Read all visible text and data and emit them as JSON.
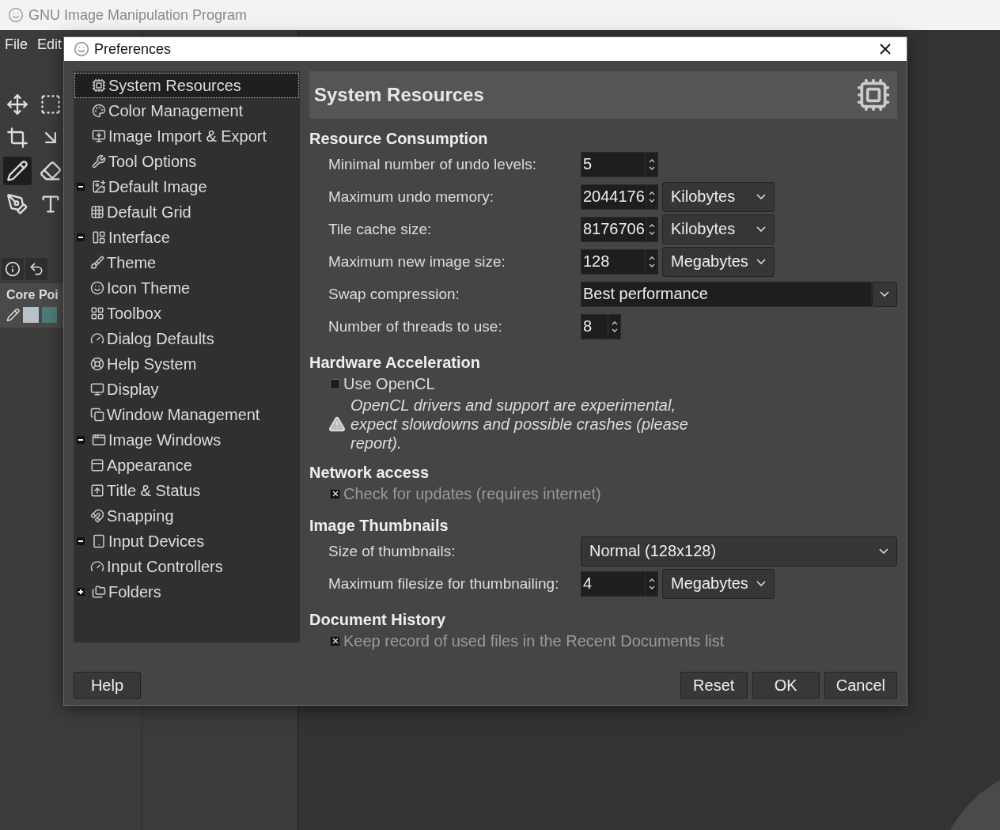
{
  "app": {
    "title": "GNU Image Manipulation Program",
    "menu": [
      "File",
      "Edit"
    ],
    "dock_label": "Core Poi"
  },
  "dialog": {
    "title": "Preferences",
    "tree": [
      {
        "label": "System Resources",
        "selected": true
      },
      {
        "label": "Color Management",
        "selected": false
      },
      {
        "label": "Image Import & Export",
        "selected": false
      },
      {
        "label": "Tool Options",
        "selected": false
      },
      {
        "label": "Default Image",
        "selected": false,
        "expanded": true,
        "children": [
          {
            "label": "Default Grid",
            "selected": false
          }
        ]
      },
      {
        "label": "Interface",
        "selected": false,
        "expanded": true,
        "children": [
          {
            "label": "Theme",
            "selected": false
          },
          {
            "label": "Icon Theme",
            "selected": false
          },
          {
            "label": "Toolbox",
            "selected": false
          },
          {
            "label": "Dialog Defaults",
            "selected": false
          },
          {
            "label": "Help System",
            "selected": false
          },
          {
            "label": "Display",
            "selected": false
          },
          {
            "label": "Window Management",
            "selected": false
          }
        ]
      },
      {
        "label": "Image Windows",
        "selected": false,
        "expanded": true,
        "children": [
          {
            "label": "Appearance",
            "selected": false
          },
          {
            "label": "Title & Status",
            "selected": false
          },
          {
            "label": "Snapping",
            "selected": false
          }
        ]
      },
      {
        "label": "Input Devices",
        "selected": false,
        "expanded": true,
        "children": [
          {
            "label": "Input Controllers",
            "selected": false
          }
        ]
      },
      {
        "label": "Folders",
        "selected": false,
        "expanded": false
      }
    ],
    "page_title": "System Resources",
    "sections": [
      {
        "heading": "Resource Consumption",
        "rows": [
          {
            "kind": "spin",
            "label": "Minimal number of undo levels:",
            "value": "5"
          },
          {
            "kind": "spin",
            "label": "Maximum undo memory:",
            "value": "2044176",
            "unit": "Kilobytes"
          },
          {
            "kind": "spin",
            "label": "Tile cache size:",
            "value": "8176706",
            "unit": "Kilobytes"
          },
          {
            "kind": "spin",
            "label": "Maximum new image size:",
            "value": "128",
            "unit": "Megabytes"
          },
          {
            "kind": "combo",
            "label": "Swap compression:",
            "value": "Best performance"
          },
          {
            "kind": "smallspin",
            "label": "Number of threads to use:",
            "value": "8"
          }
        ]
      },
      {
        "heading": "Hardware Acceleration",
        "rows": [
          {
            "kind": "check",
            "label": "Use OpenCL",
            "checked": false,
            "disabled": false
          },
          {
            "kind": "warning",
            "text": "OpenCL drivers and support are experimental, expect slowdowns and possible crashes (please report)."
          }
        ]
      },
      {
        "heading": "Network access",
        "rows": [
          {
            "kind": "check",
            "label": "Check for updates (requires internet)",
            "checked": true,
            "disabled": true
          }
        ]
      },
      {
        "heading": "Image Thumbnails",
        "rows": [
          {
            "kind": "wide_combo",
            "label": "Size of thumbnails:",
            "value": "Normal (128x128)"
          },
          {
            "kind": "spin",
            "label": "Maximum filesize for thumbnailing:",
            "value": "4",
            "unit": "Megabytes"
          }
        ]
      },
      {
        "heading": "Document History",
        "rows": [
          {
            "kind": "check",
            "label": "Keep record of used files in the Recent Documents list",
            "checked": true,
            "disabled": true
          }
        ]
      }
    ],
    "buttons_left": [
      "Help"
    ],
    "buttons_right": [
      "Reset",
      "OK",
      "Cancel"
    ]
  }
}
